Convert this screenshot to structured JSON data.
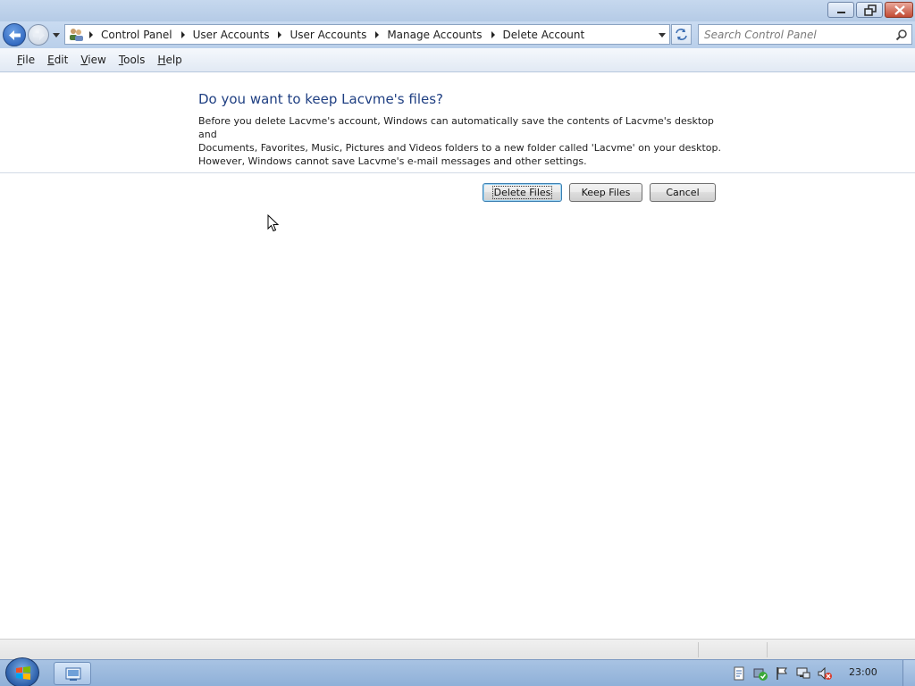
{
  "window": {
    "controls": [
      "minimize-icon",
      "maximize-icon",
      "close-icon"
    ]
  },
  "navigation": {
    "breadcrumbs": [
      "Control Panel",
      "User Accounts",
      "User Accounts",
      "Manage Accounts",
      "Delete Account"
    ],
    "search_placeholder": "Search Control Panel"
  },
  "menu": {
    "items": [
      {
        "label": "File",
        "accel": "F",
        "rest": "ile"
      },
      {
        "label": "Edit",
        "accel": "E",
        "rest": "dit"
      },
      {
        "label": "View",
        "accel": "V",
        "rest": "iew"
      },
      {
        "label": "Tools",
        "accel": "T",
        "rest": "ools"
      },
      {
        "label": "Help",
        "accel": "H",
        "rest": "elp"
      }
    ]
  },
  "dialog": {
    "heading": "Do you want to keep Lacvme's files?",
    "description_lines": [
      "Before you delete Lacvme's account, Windows can automatically save the contents of Lacvme's desktop and",
      "Documents, Favorites, Music, Pictures and Videos folders to a new folder called 'Lacvme' on your desktop.",
      "However, Windows cannot save Lacvme's e-mail messages and other settings."
    ],
    "buttons": {
      "delete_files": "Delete Files",
      "keep_files": "Keep Files",
      "cancel": "Cancel"
    }
  },
  "taskbar": {
    "clock": "23:00",
    "tray_icons": [
      "action-center-icon",
      "security-check-icon",
      "flag-icon",
      "network-icon",
      "volume-muted-icon"
    ]
  },
  "colors": {
    "heading": "#1f3f82",
    "titlebar": "#c6d8ee",
    "taskbar": "#9ab8dd"
  }
}
